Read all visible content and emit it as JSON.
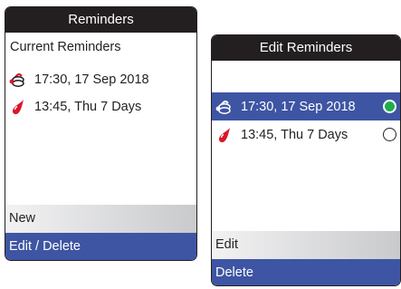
{
  "left_screen": {
    "title": "Reminders",
    "subtitle": "Current Reminders",
    "reminders": [
      {
        "icon": "glucose-test-reminder-icon",
        "text": "17:30, 17 Sep 2018"
      },
      {
        "icon": "blood-drop-reminder-icon",
        "text": "13:45, Thu 7 Days"
      }
    ],
    "menu": [
      {
        "label": "New",
        "selected": false
      },
      {
        "label": "Edit / Delete",
        "selected": true
      }
    ]
  },
  "right_screen": {
    "title": "Edit Reminders",
    "reminders": [
      {
        "icon": "glucose-test-reminder-icon",
        "text": "17:30, 17 Sep 2018",
        "selected": true
      },
      {
        "icon": "blood-drop-reminder-icon",
        "text": "13:45, Thu 7 Days",
        "selected": false
      }
    ],
    "menu": [
      {
        "label": "Edit",
        "selected": false
      },
      {
        "label": "Delete",
        "selected": true
      }
    ]
  },
  "colors": {
    "title_bar": "#231f20",
    "highlight": "#3e55a3",
    "radio_on": "#1fae4b",
    "drop_red": "#d7182a"
  }
}
